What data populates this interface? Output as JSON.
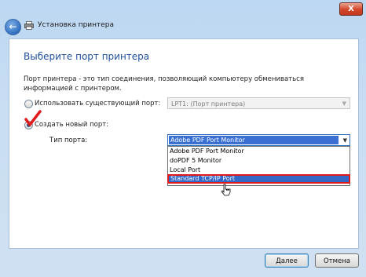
{
  "window": {
    "title": "Установка принтера",
    "close_label": "X"
  },
  "page": {
    "heading": "Выберите порт принтера",
    "description": "Порт принтера - это тип соединения, позволяющий компьютеру обмениваться информацией с принтером."
  },
  "options": {
    "use_existing": {
      "label": "Использовать существующий порт:",
      "selected": false,
      "combo_value": "LPT1: (Порт принтера)"
    },
    "create_new": {
      "label": "Создать новый порт:",
      "selected": true
    }
  },
  "port_type": {
    "label": "Тип порта:",
    "value": "Adobe PDF Port Monitor",
    "items": [
      "Adobe PDF Port Monitor",
      "doPDF  5 Monitor",
      "Local Port",
      "Standard TCP/IP Port"
    ],
    "highlighted_index": 3
  },
  "buttons": {
    "next": "Далее",
    "cancel": "Отмена"
  },
  "colors": {
    "heading": "#1f4f99",
    "highlight": "#3268c8",
    "annotation_red": "#e01b1b"
  }
}
